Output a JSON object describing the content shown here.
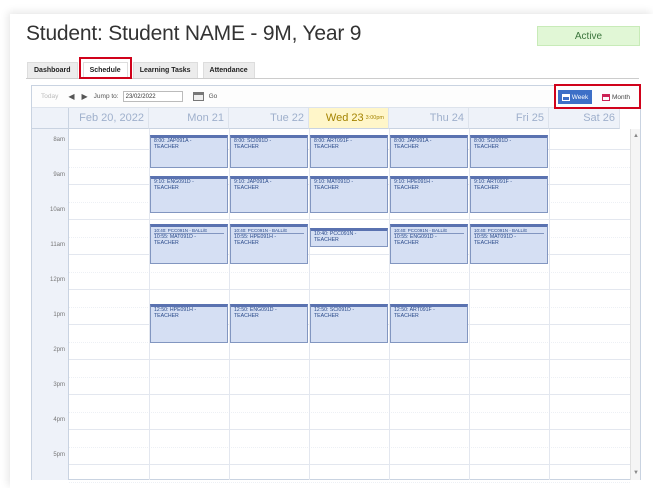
{
  "page": {
    "title": "Student: Student NAME - 9M, Year 9",
    "status": "Active"
  },
  "tabs": [
    {
      "label": "Dashboard"
    },
    {
      "label": "Schedule"
    },
    {
      "label": "Learning Tasks"
    },
    {
      "label": "Attendance"
    }
  ],
  "toolbar": {
    "today_label": "Today",
    "prev_icon": "◀",
    "next_icon": "▶",
    "jump_label": "Jump to:",
    "jump_date": "23/02/2022",
    "go_label": "Go",
    "week_label": "Week",
    "month_label": "Month"
  },
  "days": [
    {
      "label": "Feb 20, 2022"
    },
    {
      "label": "Mon 21"
    },
    {
      "label": "Tue 22"
    },
    {
      "label": "Wed 23",
      "note": "3:00pm"
    },
    {
      "label": "Thu 24"
    },
    {
      "label": "Fri 25"
    },
    {
      "label": "Sat 26"
    }
  ],
  "times": [
    "8am",
    "9am",
    "10am",
    "11am",
    "12pm",
    "1pm",
    "2pm",
    "3pm",
    "4pm",
    "5pm"
  ],
  "events": [
    {
      "day": 1,
      "start": 8.0,
      "end": 9.0,
      "title": "8:00: JAP091A -",
      "teacher": "TEACHER"
    },
    {
      "day": 2,
      "start": 8.0,
      "end": 9.0,
      "title": "8:00: SCI091D -",
      "teacher": "TEACHER"
    },
    {
      "day": 3,
      "start": 8.0,
      "end": 9.0,
      "title": "8:00: ART091F -",
      "teacher": "TEACHER"
    },
    {
      "day": 4,
      "start": 8.0,
      "end": 9.0,
      "title": "8:00: JAP091A -",
      "teacher": "TEACHER"
    },
    {
      "day": 5,
      "start": 8.0,
      "end": 9.0,
      "title": "8:00: SCI091D -",
      "teacher": "TEACHER"
    },
    {
      "day": 1,
      "start": 9.17,
      "end": 10.3,
      "title": "9:10: ENG091D -",
      "teacher": "TEACHER"
    },
    {
      "day": 2,
      "start": 9.17,
      "end": 10.3,
      "title": "9:10: JAP091A -",
      "teacher": "TEACHER"
    },
    {
      "day": 3,
      "start": 9.17,
      "end": 10.3,
      "title": "9:10: MAT091D -",
      "teacher": "TEACHER"
    },
    {
      "day": 4,
      "start": 9.17,
      "end": 10.3,
      "title": "9:10: HPE091H -",
      "teacher": "TEACHER"
    },
    {
      "day": 5,
      "start": 9.17,
      "end": 10.3,
      "title": "9:10: ART091F -",
      "teacher": "TEACHER"
    },
    {
      "day": 1,
      "start": 10.55,
      "end": 11.75,
      "badge": "10:40: PCC091N - BALL/E",
      "title": "10:55: MAT091D -",
      "teacher": "TEACHER"
    },
    {
      "day": 2,
      "start": 10.55,
      "end": 11.75,
      "badge": "10:40: PCC091N - BALL/E",
      "title": "10:55: HPE091H -",
      "teacher": "TEACHER"
    },
    {
      "day": 3,
      "start": 10.67,
      "end": 11.25,
      "title": "10:40: PCC091N -",
      "teacher": "TEACHER"
    },
    {
      "day": 4,
      "start": 10.55,
      "end": 11.75,
      "badge": "10:40: PCC091N - BALL/E",
      "title": "10:55: ENG091D -",
      "teacher": "TEACHER"
    },
    {
      "day": 5,
      "start": 10.55,
      "end": 11.75,
      "badge": "10:40: PCC091N - BALL/E",
      "title": "10:55: MAT091D -",
      "teacher": "TEACHER"
    },
    {
      "day": 1,
      "start": 12.83,
      "end": 14.0,
      "title": "12:50: HPE091H -",
      "teacher": "TEACHER"
    },
    {
      "day": 2,
      "start": 12.83,
      "end": 14.0,
      "title": "12:50: ENG091D -",
      "teacher": "TEACHER"
    },
    {
      "day": 3,
      "start": 12.83,
      "end": 14.0,
      "title": "12:50: SCI091D -",
      "teacher": "TEACHER"
    },
    {
      "day": 4,
      "start": 12.83,
      "end": 14.0,
      "title": "12:50: ART091F -",
      "teacher": "TEACHER"
    }
  ]
}
